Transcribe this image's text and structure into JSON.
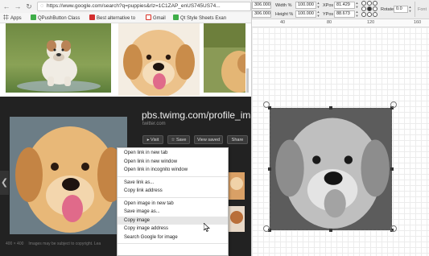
{
  "browser": {
    "url": "https://www.google.com/search?q=puppies&rlz=1C1ZAP_enUS745US74...",
    "bookmarks": [
      {
        "label": "Apps",
        "color": "#4a4a4a"
      },
      {
        "label": "QPushButton Class",
        "color": "#3fae49"
      },
      {
        "label": "Best alternative to",
        "color": "#d32f2f"
      },
      {
        "label": "Gmail",
        "color": "#d93025"
      },
      {
        "label": "Qt Style Sheets Exan",
        "color": "#3fae49"
      }
    ],
    "panel": {
      "title": "pbs.twimg.com/profile_ima",
      "site": "twitter.com",
      "buttons": [
        "Visit",
        "Save",
        "View saved",
        "Share"
      ],
      "dimensions": "400 × 400",
      "footer": "Images may be subject to copyright. Lea"
    },
    "context_menu": {
      "group1": [
        "Open link in new tab",
        "Open link in new window",
        "Open link in incognito window"
      ],
      "group2": [
        "Save link as...",
        "Copy link address"
      ],
      "group3": [
        "Open image in new tab",
        "Save image as...",
        "Copy image",
        "Copy image address",
        "Search Google for image"
      ],
      "highlighted": "Copy image"
    }
  },
  "designer": {
    "props": {
      "left_values": [
        "306.000",
        "306.000"
      ],
      "width_label": "Width %",
      "width_value": "100.000",
      "height_label": "Height %",
      "height_value": "100.000",
      "xpos_label": "XPos",
      "xpos_value": "81.429",
      "ypos_label": "YPos",
      "ypos_value": "88.673",
      "rotate_label": "Rotate",
      "rotate_value": "0.0",
      "font_label": "Font"
    },
    "ruler_labels": [
      "40",
      "80",
      "120",
      "160"
    ]
  },
  "colors": {
    "panel_bg": "#222222",
    "menu_highlight": "#e6e6e6",
    "designer_grid": "#ececec"
  }
}
